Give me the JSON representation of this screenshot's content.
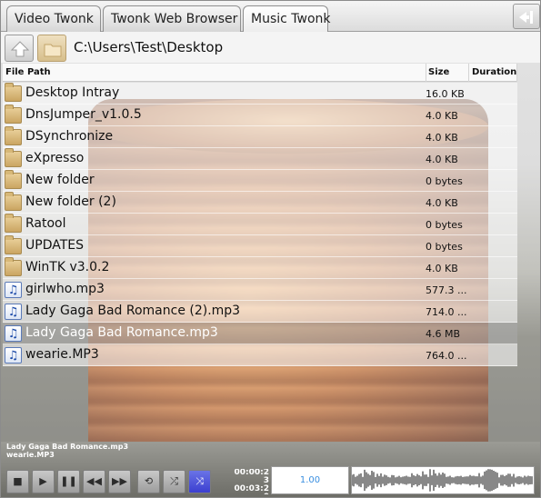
{
  "tabs": [
    {
      "label": "Video Twonk",
      "active": false
    },
    {
      "label": "Twonk Web Browser",
      "active": false
    },
    {
      "label": "Music Twonk",
      "active": true
    }
  ],
  "nav": {
    "path": "C:\\Users\\Test\\Desktop"
  },
  "columns": {
    "path": "File Path",
    "size": "Size",
    "duration": "Duration"
  },
  "files": [
    {
      "type": "folder",
      "name": "Desktop Intray",
      "size": "16.0 KB"
    },
    {
      "type": "folder",
      "name": "DnsJumper_v1.0.5",
      "size": "4.0 KB"
    },
    {
      "type": "folder",
      "name": "DSynchronize",
      "size": "4.0 KB"
    },
    {
      "type": "folder",
      "name": "eXpresso",
      "size": "4.0 KB"
    },
    {
      "type": "folder",
      "name": "New folder",
      "size": "0 bytes"
    },
    {
      "type": "folder",
      "name": "New folder (2)",
      "size": "4.0 KB"
    },
    {
      "type": "folder",
      "name": "Ratool",
      "size": "0 bytes"
    },
    {
      "type": "folder",
      "name": "UPDATES",
      "size": "0 bytes"
    },
    {
      "type": "folder",
      "name": "WinTK v3.0.2",
      "size": "4.0 KB"
    },
    {
      "type": "music",
      "name": "girlwho.mp3",
      "size": "577.3 ..."
    },
    {
      "type": "music",
      "name": "Lady Gaga Bad Romance (2).mp3",
      "size": "714.0 ..."
    },
    {
      "type": "music",
      "name": "Lady Gaga Bad Romance.mp3",
      "size": "4.6 MB",
      "selected": true
    },
    {
      "type": "music",
      "name": "wearie.MP3",
      "size": "764.0 ..."
    }
  ],
  "player": {
    "current_track": "Lady Gaga Bad Romance.mp3",
    "next_track": "wearie.MP3",
    "time_text": "00:00:2\n3\n00:03:2\n0",
    "speed": "1.00",
    "icons": [
      "stop-icon",
      "play-icon",
      "pause-icon",
      "previous-icon",
      "next-icon",
      "repeat-icon",
      "shuffle-icon",
      "crossfade-icon"
    ],
    "active_color": "#3b3fd0"
  }
}
